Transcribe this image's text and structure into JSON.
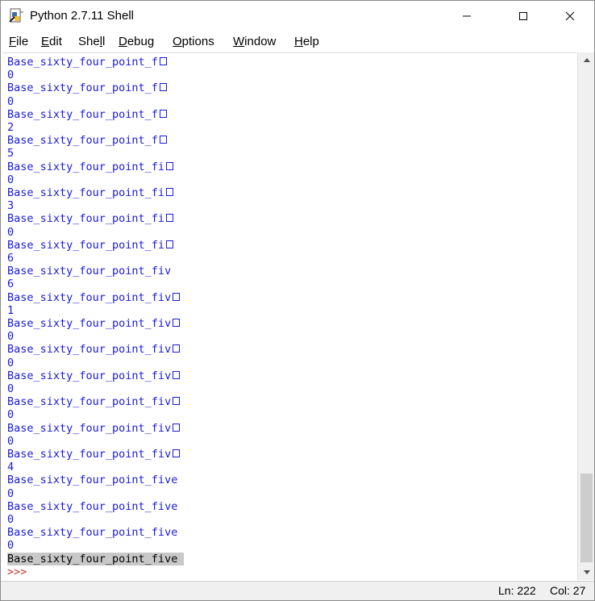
{
  "window": {
    "title": "Python 2.7.11 Shell",
    "icon": "python-idle-icon"
  },
  "menu": {
    "items": [
      {
        "mnemonic": "F",
        "rest": "ile"
      },
      {
        "mnemonic": "E",
        "rest": "dit"
      },
      {
        "pre": "She",
        "mnemonic": "l",
        "rest": "l"
      },
      {
        "mnemonic": "D",
        "rest": "ebug"
      },
      {
        "mnemonic": "O",
        "rest": "ptions"
      },
      {
        "mnemonic": "W",
        "rest": "indow"
      },
      {
        "mnemonic": "H",
        "rest": "elp"
      }
    ]
  },
  "output": {
    "lines": [
      {
        "text": "Base_sixty_four_point_f",
        "box": true
      },
      {
        "text": "0"
      },
      {
        "text": "Base_sixty_four_point_f",
        "box": true
      },
      {
        "text": "0"
      },
      {
        "text": "Base_sixty_four_point_f",
        "box": true
      },
      {
        "text": "2"
      },
      {
        "text": "Base_sixty_four_point_f",
        "box": true
      },
      {
        "text": "5"
      },
      {
        "text": "Base_sixty_four_point_fi",
        "box": true
      },
      {
        "text": "0"
      },
      {
        "text": "Base_sixty_four_point_fi",
        "box": true
      },
      {
        "text": "3"
      },
      {
        "text": "Base_sixty_four_point_fi",
        "box": true
      },
      {
        "text": "0"
      },
      {
        "text": "Base_sixty_four_point_fi",
        "box": true
      },
      {
        "text": "6"
      },
      {
        "text": "Base_sixty_four_point_fiv",
        "box": false
      },
      {
        "text": "6"
      },
      {
        "text": "Base_sixty_four_point_fiv",
        "box": true
      },
      {
        "text": "1"
      },
      {
        "text": "Base_sixty_four_point_fiv",
        "box": true
      },
      {
        "text": "0"
      },
      {
        "text": "Base_sixty_four_point_fiv",
        "box": true
      },
      {
        "text": "0"
      },
      {
        "text": "Base_sixty_four_point_fiv",
        "box": true
      },
      {
        "text": "0"
      },
      {
        "text": "Base_sixty_four_point_fiv",
        "box": true
      },
      {
        "text": "0"
      },
      {
        "text": "Base_sixty_four_point_fiv",
        "box": true
      },
      {
        "text": "0"
      },
      {
        "text": "Base_sixty_four_point_fiv",
        "box": true
      },
      {
        "text": "4"
      },
      {
        "text": "Base_sixty_four_point_five"
      },
      {
        "text": "0"
      },
      {
        "text": "Base_sixty_four_point_five"
      },
      {
        "text": "0"
      },
      {
        "text": "Base_sixty_four_point_five"
      },
      {
        "text": "0"
      }
    ],
    "last_line": "Base_sixty_four_point_five",
    "prompt": ">>>"
  },
  "status": {
    "line": "Ln: 222",
    "col": "Col: 27"
  }
}
